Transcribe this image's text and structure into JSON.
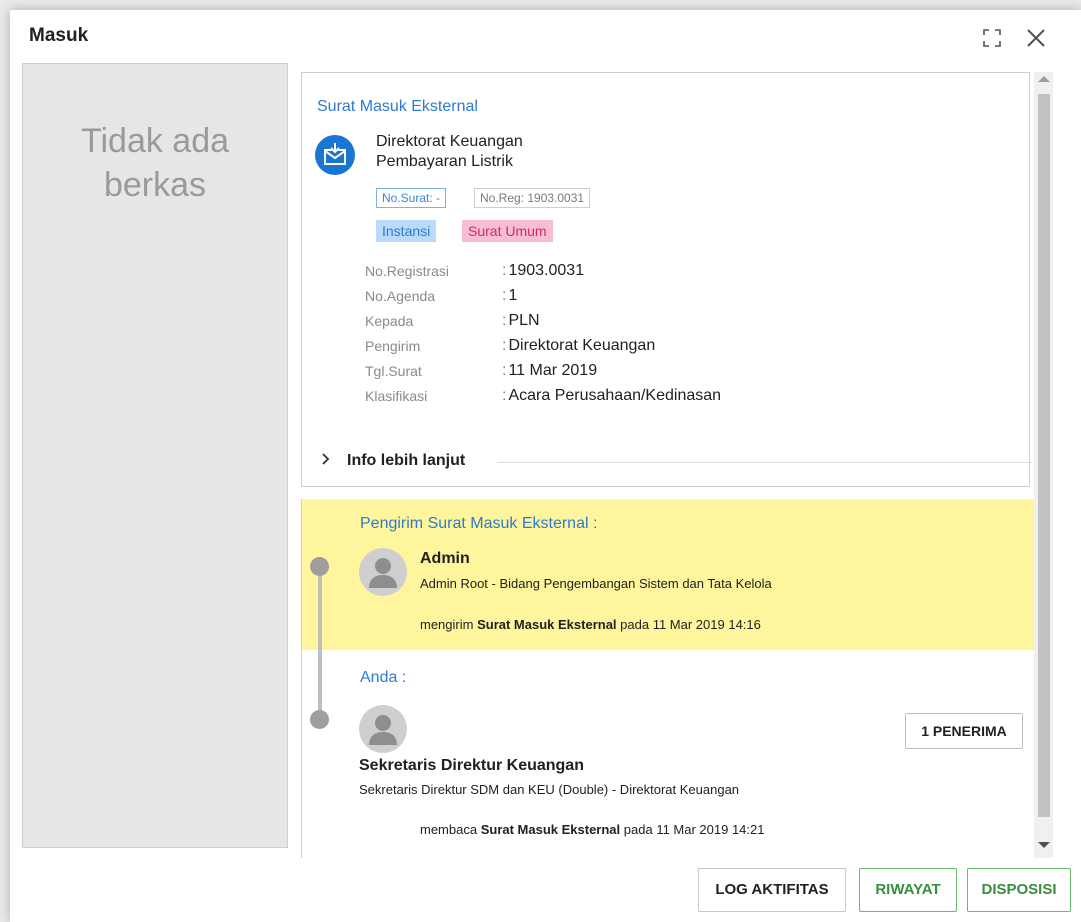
{
  "dialog": {
    "title": "Masuk"
  },
  "preview": {
    "empty_line1": "Tidak ada",
    "empty_line2": "berkas"
  },
  "letter": {
    "type": "Surat Masuk Eksternal",
    "sender": "Direktorat Keuangan",
    "subject": "Pembayaran Listrik",
    "tag_no_surat": "No.Surat: -",
    "tag_no_reg": "No.Reg: 1903.0031",
    "tag_instansi": "Instansi",
    "tag_kategori": "Surat Umum",
    "details": [
      {
        "label": "No.Registrasi",
        "value": "1903.0031"
      },
      {
        "label": "No.Agenda",
        "value": "1"
      },
      {
        "label": "Kepada",
        "value": "PLN"
      },
      {
        "label": "Pengirim",
        "value": "Direktorat Keuangan"
      },
      {
        "label": "Tgl.Surat",
        "value": "11 Mar 2019"
      },
      {
        "label": "Klasifikasi",
        "value": "Acara Perusahaan/Kedinasan"
      }
    ],
    "more_info": "Info lebih lanjut"
  },
  "timeline": {
    "sender": {
      "heading": "Pengirim Surat Masuk Eksternal :",
      "name": "Admin",
      "role": "Admin Root - Bidang Pengembangan Sistem dan Tata Kelola",
      "verb": "mengirim",
      "object": "Surat Masuk Eksternal",
      "time": "pada 11 Mar 2019 14:16"
    },
    "you": {
      "heading": "Anda :",
      "name": "Sekretaris Direktur Keuangan",
      "role": "Sekretaris Direktur SDM dan KEU (Double) - Direktorat Keuangan",
      "verb": "membaca",
      "object": "Surat Masuk Eksternal",
      "time": "pada 11 Mar 2019 14:21",
      "recipients_button": "1 PENERIMA"
    }
  },
  "footer": {
    "log_button": "LOG AKTIFITAS",
    "history_button": "RIWAYAT",
    "disposition_button": "DISPOSISI"
  },
  "colors": {
    "accent_blue": "#2e7bd1",
    "highlight_yellow": "#fff59d",
    "green": "#388e3c",
    "pink_tag": "#f7bdd3"
  },
  "icons": [
    "expand-icon",
    "close-icon",
    "mail-download-icon",
    "chevron-right-icon",
    "user-avatar-icon",
    "scroll-up-icon",
    "scroll-down-icon"
  ]
}
